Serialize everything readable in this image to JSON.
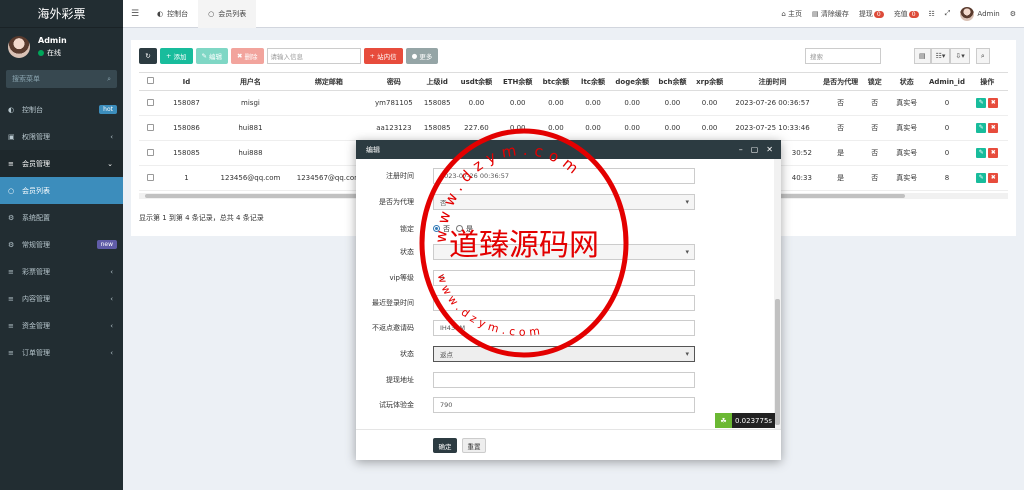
{
  "sidebar": {
    "logo": "海外彩票",
    "user_name": "Admin",
    "user_status": "在线",
    "search_placeholder": "搜索菜单",
    "items": [
      {
        "label": "控制台",
        "badge": "hot"
      },
      {
        "label": "权限管理"
      },
      {
        "label": "会员管理"
      },
      {
        "label": "会员列表"
      },
      {
        "label": "系统配置"
      },
      {
        "label": "常规管理",
        "badge": "new"
      },
      {
        "label": "彩票管理"
      },
      {
        "label": "内容管理"
      },
      {
        "label": "资金管理"
      },
      {
        "label": "订单管理"
      }
    ]
  },
  "topbar": {
    "tabs": [
      "控制台",
      "会员列表"
    ],
    "home": "主页",
    "clear_cache": "清除缓存",
    "withdraw": "提现",
    "withdraw_count": "0",
    "recharge": "充值",
    "recharge_count": "0",
    "admin": "Admin"
  },
  "toolbar": {
    "add": "添加",
    "edit": "编辑",
    "delete": "删除",
    "search_placeholder": "请输入信息",
    "site_message": "站内信",
    "more": "更多",
    "right_search_placeholder": "搜索"
  },
  "table": {
    "headers": [
      "Id",
      "用户名",
      "绑定邮箱",
      "密码",
      "上级id",
      "usdt余额",
      "ETH余额",
      "btc余额",
      "ltc余额",
      "doge余额",
      "bch余额",
      "xrp余额",
      "注册时间",
      "是否为代理",
      "锁定",
      "状态",
      "Admin_id",
      "操作"
    ],
    "rows": [
      [
        "158087",
        "misgi",
        "",
        "ym781105",
        "158085",
        "0.00",
        "0.00",
        "0.00",
        "0.00",
        "0.00",
        "0.00",
        "0.00",
        "2023-07-26 00:36:57",
        "否",
        "否",
        "真实号",
        "0"
      ],
      [
        "158086",
        "hui881",
        "",
        "aa123123",
        "158085",
        "227.60",
        "0.00",
        "0.00",
        "0.00",
        "0.00",
        "0.00",
        "0.00",
        "2023-07-25 10:33:46",
        "否",
        "否",
        "真实号",
        "0"
      ],
      [
        "158085",
        "hui888",
        "",
        "",
        "",
        "",
        "",
        "",
        "",
        "",
        "",
        "",
        "30:52",
        "是",
        "否",
        "真实号",
        "0"
      ],
      [
        "1",
        "123456@qq.com",
        "1234567@qq.com",
        "",
        "",
        "",
        "",
        "",
        "",
        "",
        "",
        "",
        "40:33",
        "是",
        "否",
        "真实号",
        "8"
      ]
    ],
    "pager": "显示第 1 到第 4 条记录，总共 4 条记录"
  },
  "dialog": {
    "title": "编辑",
    "fields": [
      {
        "label": "注册时间",
        "value": "2023-07-26 00:36:57"
      },
      {
        "label": "是否为代理",
        "value": "否"
      },
      {
        "label": "锁定",
        "options": [
          "否",
          "是"
        ]
      },
      {
        "label": "状态",
        "value": ""
      },
      {
        "label": "vip等级",
        "value": "0"
      },
      {
        "label": "最近登录时间",
        "value": ""
      },
      {
        "label": "不返点邀请码",
        "value": "IH43BM"
      },
      {
        "label": "状态",
        "value": "返点"
      },
      {
        "label": "提现地址",
        "value": ""
      },
      {
        "label": "试玩体验金",
        "value": "790"
      }
    ],
    "ok": "确定",
    "reset": "重置"
  },
  "timer": "0.023775s",
  "watermark": {
    "center_text": "道臻源码网",
    "ring_top": "www.dzym.com",
    "ring_bottom": "www.dzym.com"
  }
}
